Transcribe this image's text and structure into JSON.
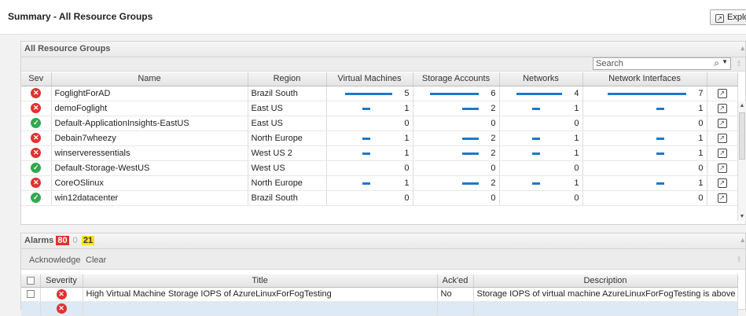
{
  "header": {
    "title": "Summary - All Resource Groups",
    "explore_label": "Explo"
  },
  "groups_panel": {
    "title": "All Resource Groups",
    "search_placeholder": "Search",
    "columns": [
      "Sev",
      "Name",
      "Region",
      "Virtual Machines",
      "Storage Accounts",
      "Networks",
      "Network Interfaces"
    ],
    "rows": [
      {
        "sev": "critical",
        "name": "FoglightForAD",
        "region": "Brazil South",
        "vm": "5",
        "storage": "6",
        "networks": "4",
        "nics": "7"
      },
      {
        "sev": "critical",
        "name": "demoFoglight",
        "region": "East US",
        "vm": "1",
        "storage": "2",
        "networks": "1",
        "nics": "1"
      },
      {
        "sev": "ok",
        "name": "Default-ApplicationInsights-EastUS",
        "region": "East US",
        "vm": "0",
        "storage": "0",
        "networks": "0",
        "nics": "0"
      },
      {
        "sev": "critical",
        "name": "Debain7wheezy",
        "region": "North Europe",
        "vm": "1",
        "storage": "2",
        "networks": "1",
        "nics": "1"
      },
      {
        "sev": "critical",
        "name": "winserveressentials",
        "region": "West US 2",
        "vm": "1",
        "storage": "2",
        "networks": "1",
        "nics": "1"
      },
      {
        "sev": "ok",
        "name": "Default-Storage-WestUS",
        "region": "West US",
        "vm": "0",
        "storage": "0",
        "networks": "0",
        "nics": "0"
      },
      {
        "sev": "critical",
        "name": "CoreOSlinux",
        "region": "North Europe",
        "vm": "1",
        "storage": "2",
        "networks": "1",
        "nics": "1"
      },
      {
        "sev": "ok",
        "name": "win12datacenter",
        "region": "Brazil South",
        "vm": "0",
        "storage": "0",
        "networks": "0",
        "nics": "0"
      }
    ]
  },
  "alarms_panel": {
    "title": "Alarms",
    "count_critical": "80",
    "count_major": "0",
    "count_warning": "21",
    "acknowledge_label": "Acknowledge",
    "clear_label": "Clear",
    "columns": [
      "Severity",
      "Title",
      "Ack'ed",
      "Description"
    ],
    "rows": [
      {
        "severity": "critical",
        "title": "High Virtual Machine Storage IOPS of AzureLinuxForFogTesting",
        "acked": "No",
        "description": "Storage IOPS of virtual machine AzureLinuxForFogTesting is above ..."
      }
    ]
  },
  "colors": {
    "critical": "#e03131",
    "ok": "#2fa84f",
    "bar": "#1f77c9",
    "warning": "#f5e21b"
  }
}
